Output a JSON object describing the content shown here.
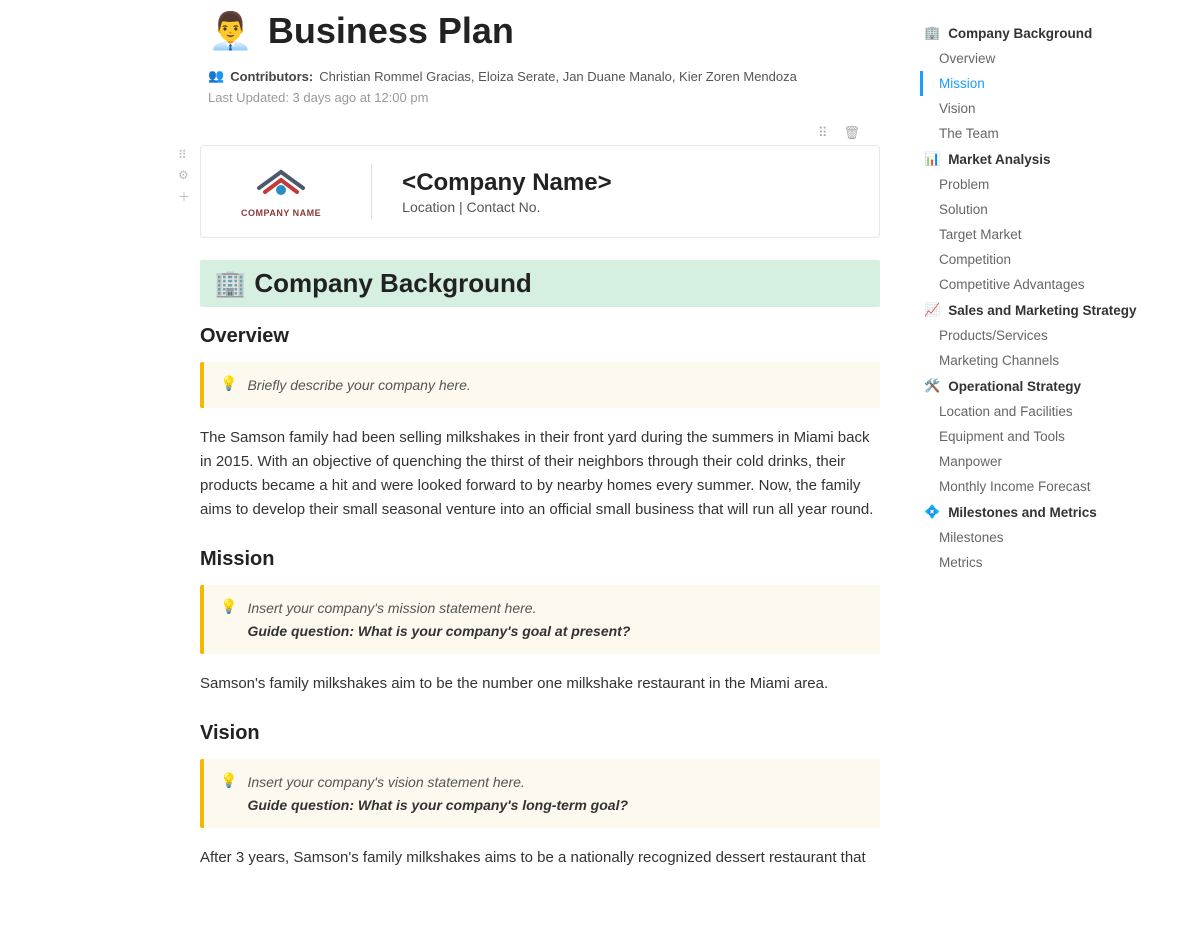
{
  "page": {
    "emoji": "👨‍💼",
    "title": "Business Plan",
    "contributors_label": "Contributors:",
    "contributors": "Christian Rommel Gracias, Eloiza Serate, Jan Duane Manalo, Kier Zoren Mendoza",
    "last_updated": "Last Updated: 3 days ago at 12:00 pm"
  },
  "company_card": {
    "logo_text": "COMPANY NAME",
    "name": "<Company Name>",
    "location_line": "Location | Contact No."
  },
  "section": {
    "emoji": "🏢",
    "title": "Company Background"
  },
  "overview": {
    "heading": "Overview",
    "callout": "Briefly describe your company here.",
    "body": "The Samson family had been selling milkshakes in their front yard during the summers in Miami back in 2015. With an objective of quenching the thirst of their neighbors through their cold drinks, their products became a hit and were looked forward to by nearby homes every summer. Now, the family aims to develop their small seasonal venture into an official small business that will run all year round."
  },
  "mission": {
    "heading": "Mission",
    "callout_line1": "Insert your company's mission statement here.",
    "callout_guide": "Guide question: What is your company's goal at present?",
    "body": "Samson's family milkshakes aim to be the number one milkshake restaurant in the Miami area."
  },
  "vision": {
    "heading": "Vision",
    "callout_line1": "Insert your company's vision statement here.",
    "callout_guide": "Guide question: What is your company's long-term goal?",
    "body": "After 3 years, Samson's family milkshakes aims to be a nationally recognized dessert restaurant that"
  },
  "toc": {
    "s1": {
      "icon": "🏢",
      "label": "Company Background",
      "items": [
        "Overview",
        "Mission",
        "Vision",
        "The Team"
      ],
      "active_index": 1
    },
    "s2": {
      "icon": "📊",
      "label": "Market Analysis",
      "items": [
        "Problem",
        "Solution",
        "Target Market",
        "Competition",
        "Competitive Advantages"
      ]
    },
    "s3": {
      "icon": "📈",
      "label": "Sales and Marketing Strategy",
      "items": [
        "Products/Services",
        "Marketing Channels"
      ]
    },
    "s4": {
      "icon": "🛠️",
      "label": "Operational Strategy",
      "items": [
        "Location and Facilities",
        "Equipment and Tools",
        "Manpower",
        "Monthly Income Forecast"
      ]
    },
    "s5": {
      "icon": "💠",
      "label": "Milestones and Metrics",
      "items": [
        "Milestones",
        "Metrics"
      ]
    }
  }
}
